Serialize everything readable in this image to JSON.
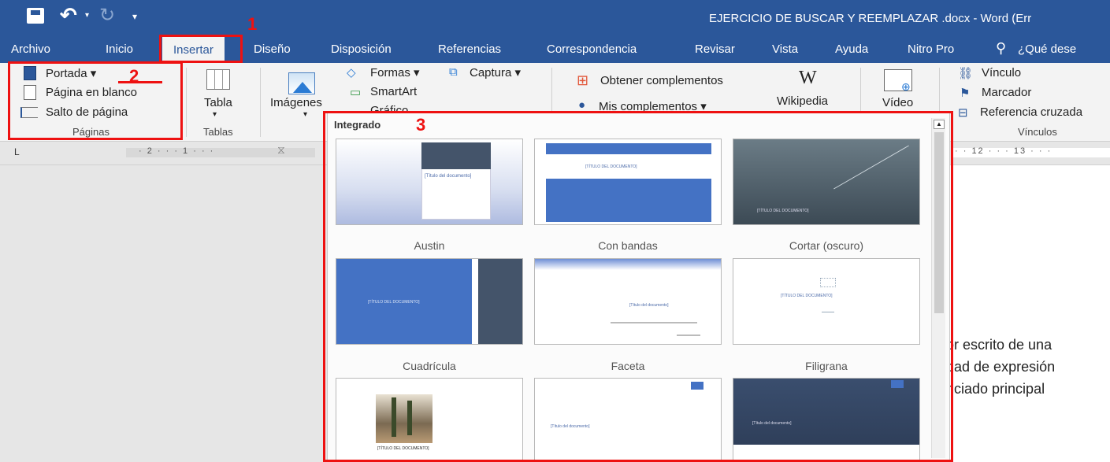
{
  "title_bar": {
    "document_title": "EJERCICIO DE BUSCAR Y REEMPLAZAR .docx  -  Word (Err",
    "qat_icons": [
      "save-icon",
      "undo-icon",
      "redo-icon",
      "customize-icon"
    ]
  },
  "tabs": [
    {
      "label": "Archivo"
    },
    {
      "label": "Inicio"
    },
    {
      "label": "Insertar"
    },
    {
      "label": "Diseño"
    },
    {
      "label": "Disposición"
    },
    {
      "label": "Referencias"
    },
    {
      "label": "Correspondencia"
    },
    {
      "label": "Revisar"
    },
    {
      "label": "Vista"
    },
    {
      "label": "Ayuda"
    },
    {
      "label": "Nitro Pro"
    },
    {
      "label": "¿Qué dese"
    }
  ],
  "ribbon": {
    "paginas": {
      "portada": "Portada",
      "pagina_en_blanco": "Página en blanco",
      "salto_de_pagina": "Salto de página",
      "group_label": "Páginas"
    },
    "tablas": {
      "tabla": "Tabla",
      "group_label": "Tablas"
    },
    "ilustraciones": {
      "imagenes": "Imágenes",
      "formas": "Formas",
      "captura": "Captura",
      "smartart": "SmartArt",
      "grafico": "Gráfico"
    },
    "complementos": {
      "obtener": "Obtener complementos",
      "mis": "Mis complementos",
      "wikipedia": "Wikipedia",
      "wikipedia_glyph": "W"
    },
    "multimedia": {
      "video": "Vídeo"
    },
    "vinculos": {
      "vinculo": "Vínculo",
      "marcador": "Marcador",
      "referencia_cruzada": "Referencia cruzada",
      "group_label": "Vínculos"
    }
  },
  "ruler": {
    "left_ticks": "· 2 · · · 1 · · ·",
    "right_ticks": "· · 12 · · · 13 · · ·",
    "tab_marker": "L"
  },
  "gallery": {
    "header": "Integrado",
    "items": [
      {
        "name": "Austin",
        "thumb_text": "[Título del documento]"
      },
      {
        "name": "Con bandas",
        "thumb_text": "[TÍTULO DEL DOCUMENTO]"
      },
      {
        "name": "Cortar (oscuro)",
        "thumb_text": "[TÍTULO DEL DOCUMENTO]"
      },
      {
        "name": "Cuadrícula",
        "thumb_text": "[TÍTULO DEL DOCUMENTO]"
      },
      {
        "name": "Faceta",
        "thumb_text": "[Título del documento]"
      },
      {
        "name": "Filigrana",
        "thumb_text": "[TÍTULO DEL DOCUMENTO]"
      },
      {
        "name": "",
        "thumb_text": "[TÍTULO DEL DOCUMENTO]"
      },
      {
        "name": "",
        "thumb_text": "[Título del documento]"
      },
      {
        "name": "",
        "thumb_text": "[Título del documento]"
      }
    ]
  },
  "document": {
    "lines": [
      "or escrito de una",
      "dad de expresión",
      "nciado principal"
    ]
  },
  "annotations": {
    "n1": "1",
    "n2": "2",
    "n3": "3"
  },
  "colors": {
    "accent": "#2b579a",
    "annotation": "#e11111"
  }
}
